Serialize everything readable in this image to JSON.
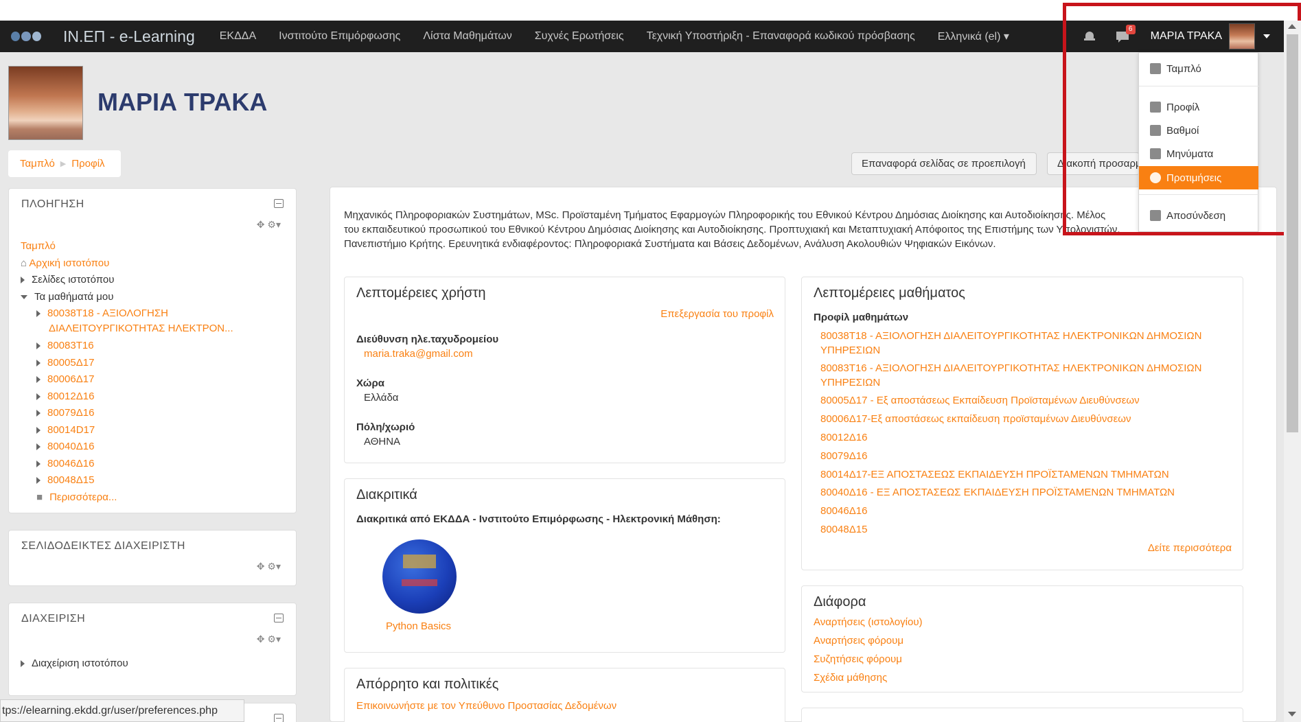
{
  "navbar": {
    "brand": "ΙΝ.ΕΠ - e-Learning",
    "items": [
      "ΕΚΔΔΑ",
      "Ινστιτούτο Επιμόρφωσης",
      "Λίστα Μαθημάτων",
      "Συχνές Ερωτήσεις",
      "Τεχνική Υποστήριξη - Επαναφορά κωδικού πρόσβασης",
      "Ελληνικά (el) ▾"
    ],
    "message_count": "6",
    "username": "ΜΑΡΙΑ ΤΡΑΚΑ"
  },
  "user_menu": {
    "items": [
      "Ταμπλό",
      "Προφίλ",
      "Βαθμοί",
      "Μηνύματα",
      "Προτιμήσεις",
      "Αποσύνδεση"
    ],
    "active": "Προτιμήσεις"
  },
  "header": {
    "title": "ΜΑΡΙΑ ΤΡΑΚΑ",
    "breadcrumb": [
      "Ταμπλό",
      "Προφίλ"
    ],
    "reset_button": "Επαναφορά σελίδας σε προεπιλογή",
    "stop_button": "Διακοπή προσαρμογής αυτής της σελίδας"
  },
  "navigation_block": {
    "title": "ΠΛΟΗΓΗΣΗ",
    "dashboard": "Ταμπλό",
    "home": "Αρχική ιστοτόπου",
    "site_pages": "Σελίδες ιστοτόπου",
    "my_courses": "Τα μαθήματά μου",
    "course_1_line1": "80038Τ18 - ΑΞΙΟΛΟΓΗΣΗ",
    "course_1_line2": "ΔΙΑΛΕΙΤΟΥΡΓΙΚΟΤΗΤΑΣ ΗΛΕΚΤΡΟΝ...",
    "courses": [
      "80083Τ16",
      "80005Δ17",
      "80006Δ17",
      "80012Δ16",
      "80079Δ16",
      "80014D17",
      "80040Δ16",
      "80046Δ16",
      "80048Δ15"
    ],
    "more": "Περισσότερα..."
  },
  "admin_bookmarks_block": {
    "title": "ΣΕΛΙΔΟΔΕΙΚΤΕΣ ΔΙΑΧΕΙΡΙΣΤΗ"
  },
  "admin_block": {
    "title": "ΔΙΑΧΕΙΡΙΣΗ",
    "site_admin": "Διαχείριση ιστοτόπου"
  },
  "description": "Μηχανικός Πληροφοριακών Συστημάτων, MSc.  Προϊσταμένη Τμήματος Εφαρμογών Πληροφορικής του Εθνικού Κέντρου Δημόσιας Διοίκησης και Αυτοδιοίκησης. Μέλος του εκπαιδευτικού προσωπικού του Εθνικού Κέντρου Δημόσιας Διοίκησης και Αυτοδιοίκησης. Προπτυχιακή και Μεταπτυχιακή Απόφοιτος της Επιστήμης των Υπολογιστών, Πανεπιστήμιο Κρήτης. Ερευνητικά ενδιαφέροντος: Πληροφοριακά Συστήματα και Βάσεις Δεδομένων, Ανάλυση Ακολουθιών Ψηφιακών Εικόνων.",
  "user_details": {
    "title": "Λεπτομέρειες χρήστη",
    "edit_link": "Επεξεργασία του προφίλ",
    "email_label": "Διεύθυνση ηλε.ταχυδρομείου",
    "email": "maria.traka@gmail.com",
    "country_label": "Χώρα",
    "country": "Ελλάδα",
    "city_label": "Πόλη/χωριό",
    "city": "ΑΘΗΝΑ"
  },
  "badges": {
    "title": "Διακριτικά",
    "subtitle": "Διακριτικά από ΕΚΔΔΑ - Ινστιτούτο Επιμόρφωσης - Ηλεκτρονική Μάθηση:",
    "badge_name": "Python Basics"
  },
  "privacy": {
    "title": "Απόρρητο και πολιτικές",
    "contact_link": "Επικοινωνήστε με τον Υπεύθυνο Προστασίας Δεδομένων"
  },
  "course_details": {
    "title": "Λεπτομέρειες μαθήματος",
    "subtitle": "Προφίλ μαθημάτων",
    "c1a": "80038Τ18 - ΑΞΙΟΛΟΓΗΣΗ ΔΙΑΛΕΙΤΟΥΡΓΙΚΟΤΗΤΑΣ ΗΛΕΚΤΡΟΝΙΚΩΝ ΔΗΜΟΣΙΩΝ",
    "c1b": "ΥΠΗΡΕΣΙΩΝ",
    "c2a": "80083Τ16 - ΑΞΙΟΛΟΓΗΣΗ ΔΙΑΛΕΙΤΟΥΡΓΙΚΟΤΗΤΑΣ ΗΛΕΚΤΡΟΝΙΚΩΝ ΔΗΜΟΣΙΩΝ",
    "c2b": "ΥΠΗΡΕΣΙΩΝ",
    "rest": [
      "80005Δ17 - Εξ αποστάσεως Εκπαίδευση Προϊσταμένων Διευθύνσεων",
      "80006Δ17-Εξ αποστάσεως εκπαίδευση προϊσταμένων Διευθύνσεων",
      "80012Δ16",
      "80079Δ16",
      "80014Δ17-ΕΞ ΑΠΟΣΤΑΣΕΩΣ ΕΚΠΑΙΔΕΥΣΗ ΠΡΟΪΣΤΑΜΕΝΩΝ ΤΜΗΜΑΤΩΝ",
      "80040Δ16 - ΕΞ ΑΠΟΣΤΑΣΕΩΣ ΕΚΠΑΙΔΕΥΣΗ ΠΡΟΪΣΤΑΜΕΝΩΝ ΤΜΗΜΑΤΩΝ",
      "80046Δ16",
      "80048Δ15"
    ],
    "see_more": "Δείτε περισσότερα"
  },
  "misc": {
    "title": "Διάφορα",
    "links": [
      "Αναρτήσεις (ιστολογίου)",
      "Αναρτήσεις φόρουμ",
      "Συζητήσεις φόρουμ",
      "Σχέδια μάθησης"
    ]
  },
  "status_url": "tps://elearning.ekdd.gr/user/preferences.php",
  "colors": {
    "accent": "#f98012",
    "navbar": "#1f1f1f",
    "title": "#2c3b6d",
    "highlight_box": "#c8141b"
  }
}
